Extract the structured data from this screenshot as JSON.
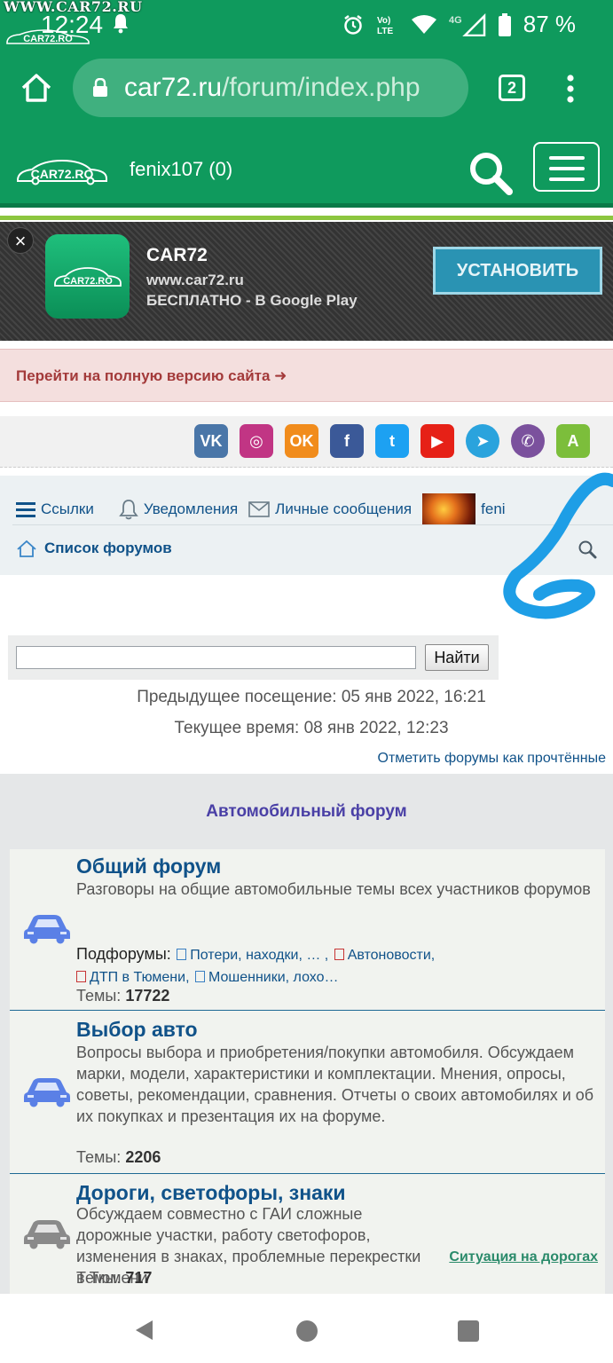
{
  "watermark": {
    "text": "WWW.CAR72.RU",
    "logo_text": "CAR72.RO"
  },
  "status_bar": {
    "time": "12:24",
    "network": "4G",
    "volte": "Vo) LTE",
    "battery": "87 %"
  },
  "browser": {
    "url_host": "car72.ru",
    "url_path": "/forum/index.php",
    "tab_count": "2"
  },
  "site_header": {
    "logo_text": "CAR72.RO",
    "user": "fenix107 (0)"
  },
  "app_banner": {
    "close": "×",
    "title": "CAR72",
    "url": "www.car72.ru",
    "free_text": "БЕСПЛАТНО - В Google Play",
    "install_label": "УСТАНОВИТЬ",
    "icon_text": "CAR72.RO"
  },
  "full_version": {
    "label": "Перейти на полную версию сайта ➜"
  },
  "social": [
    {
      "name": "vk",
      "label": "VK",
      "color": "#4a76a8"
    },
    {
      "name": "instagram",
      "label": "◎",
      "color": "#c13584"
    },
    {
      "name": "odnoklassniki",
      "label": "OK",
      "color": "#f18c1c"
    },
    {
      "name": "facebook",
      "label": "f",
      "color": "#3b5998"
    },
    {
      "name": "twitter",
      "label": "t",
      "color": "#1da1f2"
    },
    {
      "name": "youtube",
      "label": "▶",
      "color": "#e62117"
    },
    {
      "name": "telegram",
      "label": "➤",
      "color": "#2aa3dd"
    },
    {
      "name": "viber",
      "label": "✆",
      "color": "#7b519d"
    },
    {
      "name": "android",
      "label": "A",
      "color": "#7cbe3b"
    }
  ],
  "nav": {
    "links": "Ссылки",
    "notifications": "Уведомления",
    "messages": "Личные сообщения",
    "user_short": "feni",
    "forum_list": "Список форумов"
  },
  "search": {
    "value": "",
    "button": "Найти"
  },
  "visit": {
    "last": "Предыдущее посещение: 05 янв 2022, 16:21",
    "current": "Текущее время: 08 янв 2022, 12:23",
    "mark_read": "Отметить форумы как прочтённые"
  },
  "category": {
    "title": "Автомобильный форум"
  },
  "forums": [
    {
      "title": "Общий форум",
      "description": "Разговоры на общие автомобильные темы всех участников форумов",
      "subforums_label": "Подфорумы:",
      "subforums": [
        "Потери, находки, … ,",
        "Автоновости,",
        "ДТП в Тюмени,",
        "Мошенники, лохо…"
      ],
      "topics_label": "Темы:",
      "topics": "17722"
    },
    {
      "title": "Выбор авто",
      "description": "Вопросы выбора и приобретения/покупки автомобиля. Обсуждаем марки, модели, характеристики и комплектации. Мнения, опросы, советы, рекомендации, сравнения. Отчеты о своих автомобилях и об их покупках и презентация их на форуме.",
      "topics_label": "Темы:",
      "topics": "2206"
    },
    {
      "title": "Дороги, светофоры, знаки",
      "description": "Обсуждаем совместно с ГАИ сложные дорожные участки, работу светофоров, изменения в знаках, проблемные перекрестки в Тюмени",
      "topics_label": "Темы:",
      "topics": "717",
      "extra_link": "Ситуация на дорогах"
    }
  ],
  "colors": {
    "brand_green": "#0f9a5d",
    "link_blue": "#105289",
    "category_purple": "#4a40a6",
    "car_blue": "#5a80e6",
    "car_gray": "#8a8a8a"
  }
}
